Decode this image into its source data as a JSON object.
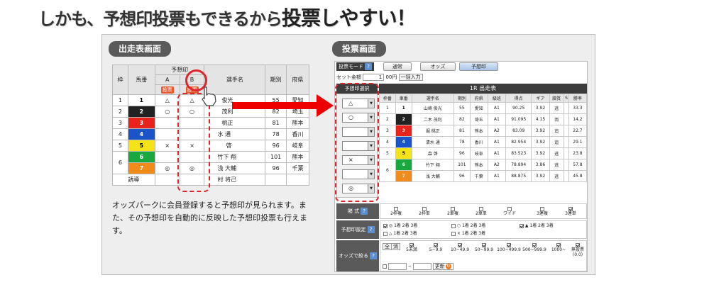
{
  "headline": {
    "main": "しかも、予想印投票もできるから",
    "emph": "投票しやすい！"
  },
  "left": {
    "tag": "出走表画面",
    "header": {
      "waku": "枠",
      "umaban": "馬番",
      "yoso": "予想印",
      "a": "A",
      "b": "B",
      "tohyo": "投票",
      "name": "選手名",
      "period": "期別",
      "pref": "府県"
    },
    "rows": [
      {
        "waku": "1",
        "num": "1",
        "bg": "#ffffff",
        "fg": "#000000",
        "a": "△",
        "b": "△",
        "name": "俊光",
        "period": "55",
        "pref": "愛知"
      },
      {
        "waku": "2",
        "num": "2",
        "bg": "#222222",
        "fg": "#ffffff",
        "a": "○",
        "b": "○",
        "name": "茂利",
        "period": "82",
        "pref": "埼玉"
      },
      {
        "waku": "3",
        "num": "3",
        "bg": "#e8231b",
        "fg": "#ffffff",
        "a": "",
        "b": "",
        "name": "桃正",
        "period": "81",
        "pref": "熊本"
      },
      {
        "waku": "4",
        "num": "4",
        "bg": "#1b53c9",
        "fg": "#ffffff",
        "a": "",
        "b": "",
        "name": "水 通",
        "period": "78",
        "pref": "香川"
      },
      {
        "waku": "5",
        "num": "5",
        "bg": "#f5e31a",
        "fg": "#000000",
        "a": "×",
        "b": "×",
        "name": "啓",
        "period": "96",
        "pref": "岐阜"
      },
      {
        "waku": "6",
        "num": "6",
        "bg": "#18a83e",
        "fg": "#ffffff",
        "a": "",
        "b": "",
        "name": "竹下 翔",
        "period": "101",
        "pref": "熊本"
      },
      {
        "waku": "",
        "num": "7",
        "bg": "#f18b1c",
        "fg": "#ffffff",
        "a": "◎",
        "b": "◎",
        "name": "浅 大輔",
        "period": "96",
        "pref": "千葉"
      }
    ],
    "footer": "誘導",
    "footer_name": "村 将己",
    "description": "オッズパークに会員登録すると予想印が見られます。また、その予想印を自動的に反映した予想印投票も行えます。"
  },
  "right": {
    "tag": "投票画面",
    "mode_label": "投票モード",
    "modes": [
      "通常",
      "オッズ",
      "予想印"
    ],
    "bet_label": "セット金額",
    "bet_value": "1",
    "bet_unit": "00円",
    "bet_all": "一括入力",
    "yoso_head": "予想印選択",
    "yoso_marks": [
      "△",
      "○",
      "",
      "",
      "×",
      "",
      "◎"
    ],
    "race_title": "1R 出走表",
    "cols": [
      "枠番",
      "車番",
      "選手名",
      "期別",
      "府県",
      "級班",
      "得点",
      "ギア",
      "脚質",
      "S",
      "勝率"
    ],
    "rows": [
      {
        "waku": "1",
        "num": "1",
        "bg": "#ffffff",
        "fg": "#000000",
        "name": "山崎 俊光",
        "period": "55",
        "pref": "愛知",
        "cls": "A1",
        "pt": "90.25",
        "gear": "3.92",
        "st": "逃",
        "rate": "33.3"
      },
      {
        "waku": "2",
        "num": "2",
        "bg": "#222222",
        "fg": "#ffffff",
        "name": "二木 茂利",
        "period": "82",
        "pref": "埼玉",
        "cls": "A1",
        "pt": "91.095",
        "gear": "4.15",
        "st": "両",
        "rate": "14.2"
      },
      {
        "waku": "3",
        "num": "3",
        "bg": "#e8231b",
        "fg": "#ffffff",
        "name": "堀 桃正",
        "period": "81",
        "pref": "熊本",
        "cls": "A2",
        "pt": "83.09",
        "gear": "3.92",
        "st": "追",
        "rate": "22.7"
      },
      {
        "waku": "4",
        "num": "4",
        "bg": "#1b53c9",
        "fg": "#ffffff",
        "name": "清水 通",
        "period": "78",
        "pref": "香川",
        "cls": "A1",
        "pt": "82.954",
        "gear": "3.92",
        "st": "追",
        "rate": "29.1"
      },
      {
        "waku": "5",
        "num": "5",
        "bg": "#f5e31a",
        "fg": "#000000",
        "name": "森 啓",
        "period": "96",
        "pref": "岐阜",
        "cls": "A1",
        "pt": "83.523",
        "gear": "3.92",
        "st": "逃",
        "rate": "23.8"
      },
      {
        "waku": "6",
        "num": "6",
        "bg": "#18a83e",
        "fg": "#ffffff",
        "name": "竹下 翔",
        "period": "101",
        "pref": "熊本",
        "cls": "A2",
        "pt": "78.894",
        "gear": "3.86",
        "st": "逃",
        "rate": "57.8"
      },
      {
        "waku": "",
        "num": "7",
        "bg": "#f18b1c",
        "fg": "#ffffff",
        "name": "浅 大輔",
        "period": "96",
        "pref": "千葉",
        "cls": "A1",
        "pt": "88.875",
        "gear": "3.92",
        "st": "逃",
        "rate": "45.8"
      }
    ],
    "shiki_label": "賭 式",
    "shiki": [
      "2枠複",
      "2枠単",
      "2車複",
      "2車単",
      "ワイド",
      "3連複",
      "3連単"
    ],
    "yoso_label": "予想印設定",
    "yoso_line1a": "◎ 1着 2着 3着",
    "yoso_line1b": "○ 1着 2着 3着",
    "yoso_line1c": "▲ 1着 2着 3着",
    "yoso_line2a": "△ 1着 2着 3着",
    "yoso_line2b": "× 1着 2着 3着",
    "odds_label": "オッズで絞る",
    "odds_all": "全",
    "odds_clear": "消",
    "odds_ranges": [
      "5未満",
      "5~9.9",
      "10~49.9",
      "50~99.9",
      "100~499.9",
      "500~999.9",
      "1000~",
      "無投票(0.0)"
    ],
    "odds_tilde": "~",
    "odds_update": "更新"
  }
}
